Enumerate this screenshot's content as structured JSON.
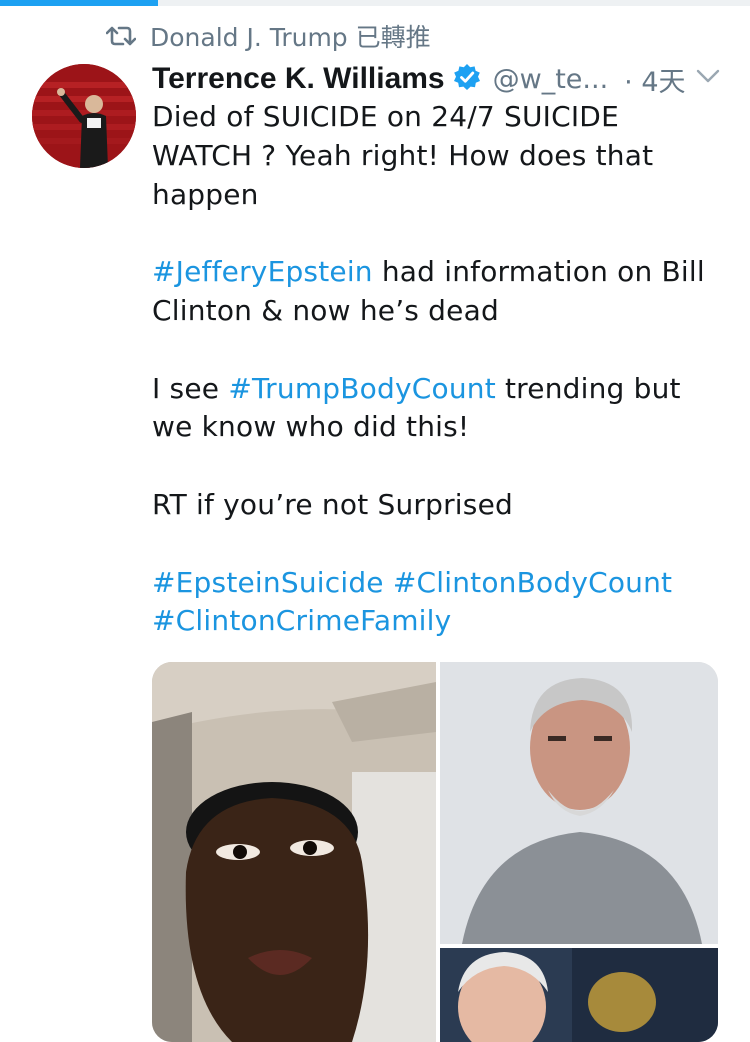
{
  "progress": {
    "fraction": 0.21
  },
  "retweet": {
    "icon": "retweet-icon",
    "text": "Donald J. Trump 已轉推"
  },
  "tweet": {
    "display_name": "Terrence K. Williams",
    "verified_icon": "verified-badge-icon",
    "handle": "@w_te...",
    "time": "· 4天",
    "menu_icon": "chevron-down-icon",
    "lines": {
      "p1a": "Died of SUICIDE on 24/7 SUICIDE",
      "p1b": "WATCH ? Yeah right! How does that",
      "p1c": "happen",
      "p2_tag": "#JefferyEpstein",
      "p2a_rest": " had information on Bill",
      "p2b": "Clinton & now he’s dead",
      "p3_pre": "I see ",
      "p3_tag": "#TrumpBodyCount",
      "p3a_rest": " trending but",
      "p3b": "we know who did this!",
      "p4": "RT if you’re not Surprised",
      "p5_tag1": "#EpsteinSuicide",
      "p5_tag2": "#ClintonBodyCount",
      "p5_tag3": "#ClintonCrimeFamily"
    }
  },
  "colors": {
    "link": "#1b95e0",
    "muted": "#657786",
    "text": "#14171a",
    "verified": "#1da1f2"
  }
}
